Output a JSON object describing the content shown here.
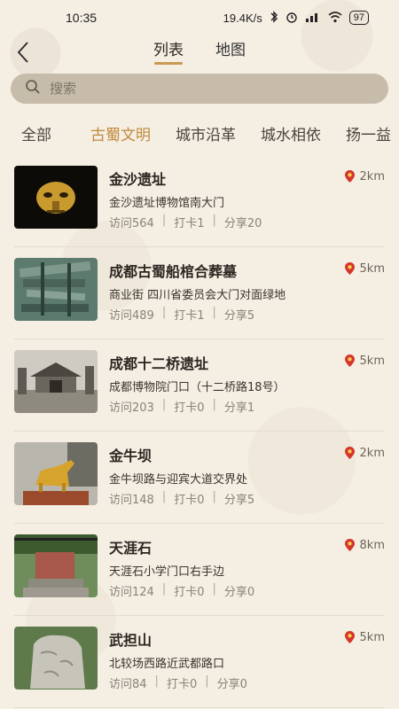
{
  "status_bar": {
    "time": "10:35",
    "network_speed": "19.4K/s",
    "battery": "97"
  },
  "nav": {
    "tabs": [
      {
        "label": "列表",
        "active": true
      },
      {
        "label": "地图",
        "active": false
      }
    ]
  },
  "search": {
    "placeholder": "搜索",
    "value": ""
  },
  "categories": [
    {
      "label": "全部",
      "active": false
    },
    {
      "label": "古蜀文明",
      "active": true
    },
    {
      "label": "城市沿革",
      "active": false
    },
    {
      "label": "城水相依",
      "active": false
    },
    {
      "label": "扬一益",
      "active": false
    }
  ],
  "colors": {
    "accent": "#c18a3c",
    "pin": "#d6342c"
  },
  "items": [
    {
      "title": "金沙遗址",
      "address": "金沙遗址博物馆南大门",
      "visits": "访问564",
      "checkins": "打卡1",
      "shares": "分享20",
      "distance": "2km"
    },
    {
      "title": "成都古蜀船棺合葬墓",
      "address": "商业街 四川省委员会大门对面绿地",
      "visits": "访问489",
      "checkins": "打卡1",
      "shares": "分享5",
      "distance": "5km"
    },
    {
      "title": "成都十二桥遗址",
      "address": "成都博物院门口（十二桥路18号）",
      "visits": "访问203",
      "checkins": "打卡0",
      "shares": "分享1",
      "distance": "5km"
    },
    {
      "title": "金牛坝",
      "address": "金牛坝路与迎宾大道交界处",
      "visits": "访问148",
      "checkins": "打卡0",
      "shares": "分享5",
      "distance": "2km"
    },
    {
      "title": "天涯石",
      "address": "天涯石小学门口右手边",
      "visits": "访问124",
      "checkins": "打卡0",
      "shares": "分享0",
      "distance": "8km"
    },
    {
      "title": "武担山",
      "address": "北较场西路近武都路口",
      "visits": "访问84",
      "checkins": "打卡0",
      "shares": "分享0",
      "distance": "5km"
    }
  ]
}
